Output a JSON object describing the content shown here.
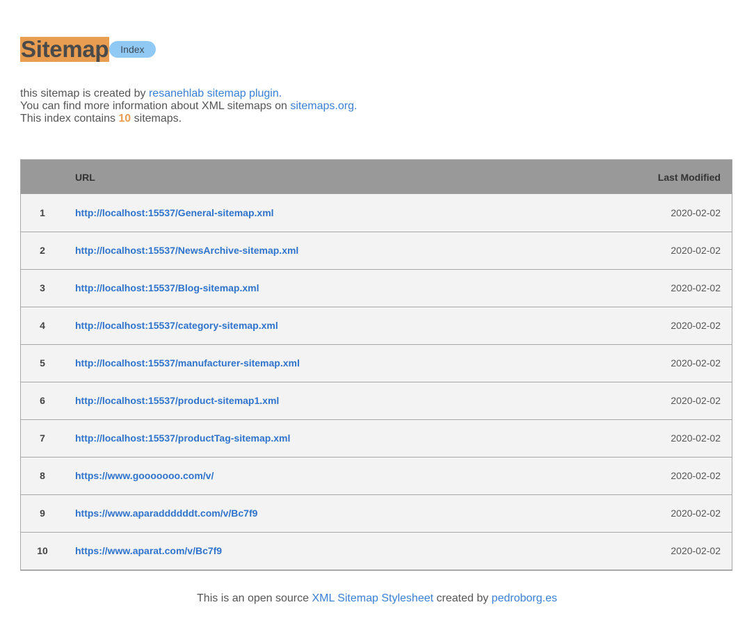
{
  "header": {
    "title": "Sitemap",
    "badge": "Index"
  },
  "intro": {
    "line1_prefix": "this sitemap is created by ",
    "line1_link": "resanehlab sitemap plugin.",
    "line2_prefix": "You can find more information about XML sitemaps on ",
    "line2_link": "sitemaps.org.",
    "line3_prefix": "This index contains ",
    "line3_count": "10",
    "line3_suffix": " sitemaps."
  },
  "table": {
    "columns": {
      "num": "",
      "url": "URL",
      "modified": "Last Modified"
    },
    "rows": [
      {
        "num": "1",
        "url": "http://localhost:15537/General-sitemap.xml",
        "modified": "2020-02-02"
      },
      {
        "num": "2",
        "url": "http://localhost:15537/NewsArchive-sitemap.xml",
        "modified": "2020-02-02"
      },
      {
        "num": "3",
        "url": "http://localhost:15537/Blog-sitemap.xml",
        "modified": "2020-02-02"
      },
      {
        "num": "4",
        "url": "http://localhost:15537/category-sitemap.xml",
        "modified": "2020-02-02"
      },
      {
        "num": "5",
        "url": "http://localhost:15537/manufacturer-sitemap.xml",
        "modified": "2020-02-02"
      },
      {
        "num": "6",
        "url": "http://localhost:15537/product-sitemap1.xml",
        "modified": "2020-02-02"
      },
      {
        "num": "7",
        "url": "http://localhost:15537/productTag-sitemap.xml",
        "modified": "2020-02-02"
      },
      {
        "num": "8",
        "url": "https://www.gooooooo.com/v/",
        "modified": "2020-02-02"
      },
      {
        "num": "9",
        "url": "https://www.aparaddddddt.com/v/Bc7f9",
        "modified": "2020-02-02"
      },
      {
        "num": "10",
        "url": "https://www.aparat.com/v/Bc7f9",
        "modified": "2020-02-02"
      }
    ]
  },
  "footer": {
    "prefix": "This is an open source ",
    "link1": "XML Sitemap Stylesheet",
    "middle": " created by ",
    "link2": "pedroborg.es"
  },
  "colors": {
    "accent": "#e89d51",
    "badge": "#91c9f5",
    "link": "#3a7fd6",
    "table_header": "#999999",
    "row_bg": "#f3f3f3"
  }
}
